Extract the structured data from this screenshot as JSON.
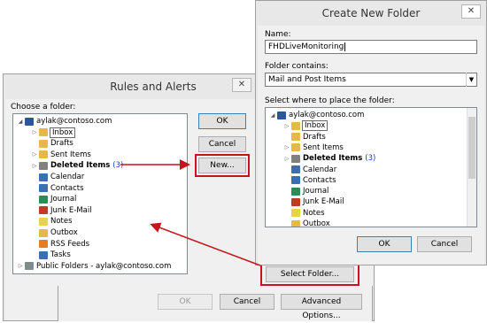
{
  "rules": {
    "title": "Rules and Alerts",
    "close": "✕",
    "choose_label": "Choose a folder:",
    "buttons": {
      "ok": "OK",
      "cancel": "Cancel",
      "new": "New...",
      "select_folder": "Select Folder..."
    },
    "bottom": {
      "ok": "OK",
      "cancel": "Cancel",
      "advanced": "Advanced Options..."
    },
    "tree": [
      {
        "label": "aylak@contoso.com",
        "count": "",
        "icon": "account-icon",
        "color": "#2b5797"
      },
      {
        "label": "Inbox",
        "count": "",
        "icon": "inbox-folder-icon",
        "color": "#e6b84c"
      },
      {
        "label": "Drafts",
        "count": "",
        "icon": "drafts-folder-icon",
        "color": "#e6b84c"
      },
      {
        "label": "Sent Items",
        "count": "",
        "icon": "sent-folder-icon",
        "color": "#e6b84c"
      },
      {
        "label": "Deleted Items",
        "count": "(3)",
        "icon": "trash-icon",
        "color": "#808080"
      },
      {
        "label": "Calendar",
        "count": "",
        "icon": "calendar-icon",
        "color": "#3a6fb0"
      },
      {
        "label": "Contacts",
        "count": "",
        "icon": "contacts-icon",
        "color": "#3a6fb0"
      },
      {
        "label": "Journal",
        "count": "",
        "icon": "journal-icon",
        "color": "#2e8b57"
      },
      {
        "label": "Junk E-Mail",
        "count": "",
        "icon": "junk-icon",
        "color": "#c0392b"
      },
      {
        "label": "Notes",
        "count": "",
        "icon": "notes-icon",
        "color": "#e6d24c"
      },
      {
        "label": "Outbox",
        "count": "",
        "icon": "outbox-folder-icon",
        "color": "#e6b84c"
      },
      {
        "label": "RSS Feeds",
        "count": "",
        "icon": "rss-icon",
        "color": "#e67e22"
      },
      {
        "label": "Tasks",
        "count": "",
        "icon": "tasks-icon",
        "color": "#3a6fb0"
      },
      {
        "label": "Public Folders - aylak@contoso.com",
        "count": "",
        "icon": "public-folders-icon",
        "color": "#7f8c8d"
      }
    ]
  },
  "create": {
    "title": "Create New Folder",
    "close": "✕",
    "name_label": "Name:",
    "name_value": "FHDLiveMonitoring",
    "contains_label": "Folder contains:",
    "contains_value": "Mail and Post Items",
    "place_label": "Select where to place the folder:",
    "buttons": {
      "ok": "OK",
      "cancel": "Cancel"
    },
    "tree": [
      {
        "label": "aylak@contoso.com",
        "count": "",
        "icon": "account-icon",
        "color": "#2b5797"
      },
      {
        "label": "Inbox",
        "count": "",
        "icon": "inbox-folder-icon",
        "color": "#e6b84c"
      },
      {
        "label": "Drafts",
        "count": "",
        "icon": "drafts-folder-icon",
        "color": "#e6b84c"
      },
      {
        "label": "Sent Items",
        "count": "",
        "icon": "sent-folder-icon",
        "color": "#e6b84c"
      },
      {
        "label": "Deleted Items",
        "count": "(3)",
        "icon": "trash-icon",
        "color": "#808080"
      },
      {
        "label": "Calendar",
        "count": "",
        "icon": "calendar-icon",
        "color": "#3a6fb0"
      },
      {
        "label": "Contacts",
        "count": "",
        "icon": "contacts-icon",
        "color": "#3a6fb0"
      },
      {
        "label": "Journal",
        "count": "",
        "icon": "journal-icon",
        "color": "#2e8b57"
      },
      {
        "label": "Junk E-Mail",
        "count": "",
        "icon": "junk-icon",
        "color": "#c0392b"
      },
      {
        "label": "Notes",
        "count": "",
        "icon": "notes-icon",
        "color": "#e6d24c"
      },
      {
        "label": "Outbox",
        "count": "",
        "icon": "outbox-folder-icon",
        "color": "#e6b84c"
      }
    ]
  },
  "colors": {
    "annotation_red": "#c4141c",
    "count_blue": "#1a3fbf"
  }
}
